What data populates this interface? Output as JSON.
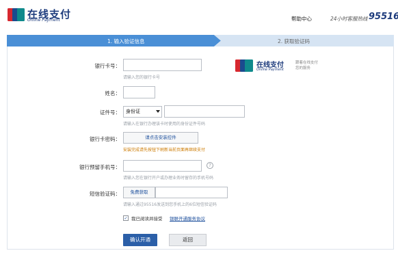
{
  "header": {
    "brand_title": "在线支付",
    "brand_subtitle": "Online Payment",
    "help_link": "帮助中心",
    "hotline_label": "24小时客服热线",
    "hotline_number": "95516"
  },
  "steps": [
    {
      "label": "1. 输入验证信息",
      "active": true
    },
    {
      "label": "2. 获取验证码",
      "active": false
    }
  ],
  "side_brand": {
    "title": "在线支付",
    "subtitle": "Online Payment",
    "note_line1": "跟着在线支付",
    "note_line2": "您的服务"
  },
  "form": {
    "card_number": {
      "label": "银行卡号：",
      "value": "",
      "hint": "请输入您的银行卡号"
    },
    "name": {
      "label": "姓名：",
      "value": ""
    },
    "id_doc": {
      "label": "证件号：",
      "type_selected": "身份证",
      "value": "",
      "hint": "请输入在银行办理该卡时使用的身份证件号码"
    },
    "card_password": {
      "label": "银行卡密码：",
      "button_label": "请点击安装控件",
      "warning": "安装完成请先按钮下刷新当前页面再继续支付"
    },
    "phone": {
      "label": "银行预留手机号：",
      "value": "",
      "help_icon": "?",
      "hint": "请输入您在银行开户或办理业务时留存的手机号码"
    },
    "sms_code": {
      "label": "短信验证码：",
      "button_label": "免费获取",
      "value": "",
      "hint": "请输入通过95516发送到您手机上的6位短信验证码"
    },
    "agreement": {
      "checked": true,
      "checkbox_mark": "✓",
      "text": "我已阅读并接受",
      "link": "银联开通服务协议"
    }
  },
  "actions": {
    "confirm_label": "确认开通",
    "back_label": "返回"
  },
  "colors": {
    "brand_blue": "#1d3b7c",
    "step_active": "#4a8fd6",
    "step_inactive": "#d6e4f3",
    "primary_button": "#2b5fa8",
    "warning": "#cc7a00"
  }
}
